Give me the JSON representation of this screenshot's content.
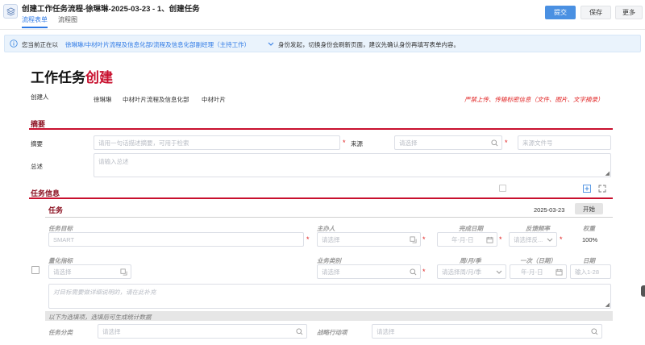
{
  "header": {
    "title": "创建工作任务流程-徐琳琳-2025-03-23 - 1、创建任务",
    "tabs": [
      "流程表单",
      "流程图"
    ],
    "buttons": {
      "submit": "提交",
      "save": "保存",
      "more": "更多"
    }
  },
  "notice": {
    "prefix": "您当前正在以",
    "identity": "徐琳琳/中材叶片流程及信息化部/流程及信息化部副经理（主持工作）",
    "suffix": "身份发起，切换身份会刷新页面，建议先确认身份再填写表单内容。"
  },
  "form": {
    "title_black": "工作任务",
    "title_red": "创建",
    "creator_label": "创建人",
    "creator_name": "徐琳琳",
    "creator_dept": "中材叶片流程及信息化部",
    "creator_company": "中材叶片",
    "warning": "严禁上传、传输标密信息（文件、图片、文字摘录）"
  },
  "summary": {
    "section_title": "摘要",
    "summary_label": "摘要",
    "summary_placeholder": "请用一句话描述摘要，可用于检索",
    "source_label": "来源",
    "source_placeholder": "请选择",
    "docno_placeholder": "来源文件号",
    "overview_label": "总述",
    "overview_placeholder": "请输入总述"
  },
  "task_info": {
    "section_title": "任务信息",
    "task_title": "任务",
    "date": "2025-03-23",
    "start_button": "开始",
    "col_goal": "任务目标",
    "col_owner": "主办人",
    "col_finish": "完成日期",
    "col_freq": "反馈频率",
    "col_weight": "权重",
    "goal_placeholder": "SMART",
    "owner_placeholder": "请选择",
    "finish_placeholder": "年-月-日",
    "freq_placeholder": "请选择反...",
    "weight_value": "100%",
    "col_indicator": "量化指标",
    "col_category": "业务类别",
    "col_period": "周/月/季",
    "col_once": "一次（日期）",
    "col_day": "日期",
    "indicator_placeholder": "请选择",
    "category_placeholder": "请选择",
    "period_placeholder": "请选择周/月/季",
    "once_placeholder": "年-月-日",
    "day_placeholder": "输入1-28",
    "detail_placeholder": "对目标需要做详细说明的，请在此补充",
    "hint": "以下为选填项，选填后可生成统计数据",
    "col_type": "任务分类",
    "type_placeholder": "请选择",
    "col_strategy": "战略行动项",
    "strategy_placeholder": "请选择"
  },
  "colors": {
    "accent": "#4a90e2",
    "brand_red": "#c8102e",
    "notice_bg": "#eaf3fc"
  }
}
